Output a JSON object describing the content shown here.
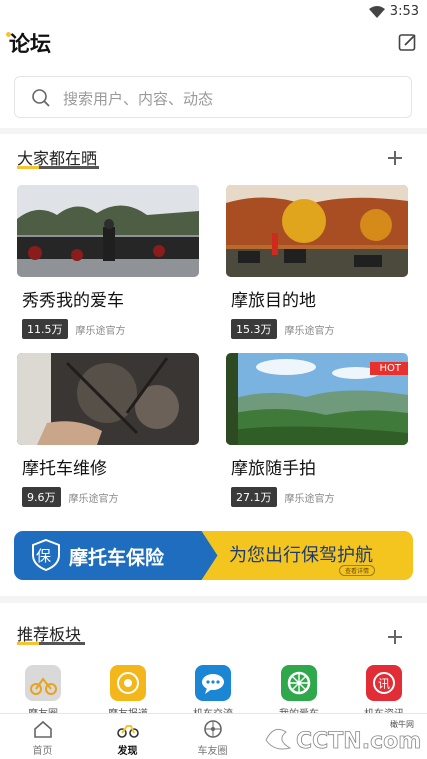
{
  "status_bar": {
    "time": "3:53"
  },
  "header": {
    "title": "论坛"
  },
  "search": {
    "placeholder": "搜索用户、内容、动态"
  },
  "section_showcase": {
    "title": "大家都在晒",
    "cards": [
      {
        "title": "秀秀我的爱车",
        "views": "11.5万",
        "author": "摩乐途官方"
      },
      {
        "title": "摩旅目的地",
        "views": "15.3万",
        "author": "摩乐途官方"
      },
      {
        "title": "摩托车维修",
        "views": "9.6万",
        "author": "摩乐途官方"
      },
      {
        "title": "摩旅随手拍",
        "views": "27.1万",
        "author": "摩乐途官方",
        "badge": "HOT"
      }
    ]
  },
  "banner": {
    "icon_text": "保",
    "left_text": "摩托车保险",
    "right_text": "为您出行保驾护航",
    "button_text": "查看详情"
  },
  "section_boards": {
    "title": "推荐板块",
    "items": [
      {
        "label": "摩友圈"
      },
      {
        "label": "摩友报道"
      },
      {
        "label": "机车交流"
      },
      {
        "label": "我的爱车"
      },
      {
        "label": "机车资讯"
      }
    ]
  },
  "tabbar": {
    "tabs": [
      {
        "label": "首页"
      },
      {
        "label": "发现"
      },
      {
        "label": "车友圈"
      }
    ]
  },
  "watermark": {
    "text": "CCTN.com",
    "corner_text": "橄牛网"
  },
  "colors": {
    "accent": "#f4c531",
    "hot": "#e8312d",
    "banner_blue": "#1e6dbf",
    "banner_yellow": "#f4c51e"
  }
}
